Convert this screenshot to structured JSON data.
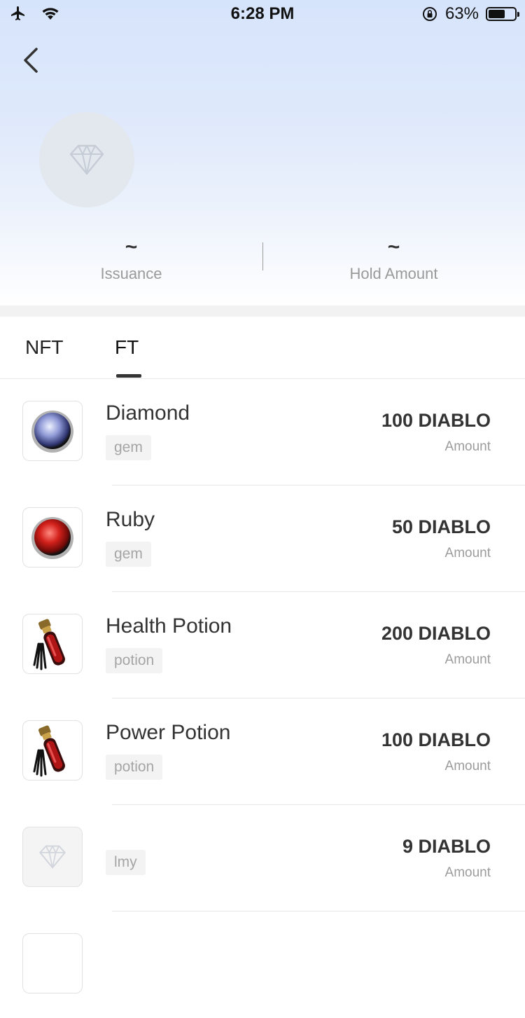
{
  "status_bar": {
    "time": "6:28 PM",
    "battery_percent": "63%",
    "battery_level": 0.63,
    "icons": [
      "airplane-icon",
      "wifi-icon",
      "orientation-lock-icon",
      "battery-icon"
    ]
  },
  "header": {
    "back_icon": "chevron-left-icon",
    "token_icon": "diamond-outline-icon"
  },
  "stats": {
    "issuance_value": "~",
    "issuance_label": "Issuance",
    "hold_value": "~",
    "hold_label": "Hold Amount"
  },
  "tabs": [
    {
      "label": "NFT",
      "active": false
    },
    {
      "label": "FT",
      "active": true
    }
  ],
  "items": [
    {
      "name": "Diamond",
      "tag": "gem",
      "amount": "100 DIABLO",
      "amount_label": "Amount",
      "icon": "diamond-gem-icon"
    },
    {
      "name": "Ruby",
      "tag": "gem",
      "amount": "50 DIABLO",
      "amount_label": "Amount",
      "icon": "ruby-gem-icon"
    },
    {
      "name": "Health Potion",
      "tag": "potion",
      "amount": "200 DIABLO",
      "amount_label": "Amount",
      "icon": "potion-icon"
    },
    {
      "name": "Power Potion",
      "tag": "potion",
      "amount": "100 DIABLO",
      "amount_label": "Amount",
      "icon": "potion-icon"
    },
    {
      "name": "",
      "tag": "lmy",
      "amount": "9 DIABLO",
      "amount_label": "Amount",
      "icon": "diamond-outline-icon"
    }
  ]
}
